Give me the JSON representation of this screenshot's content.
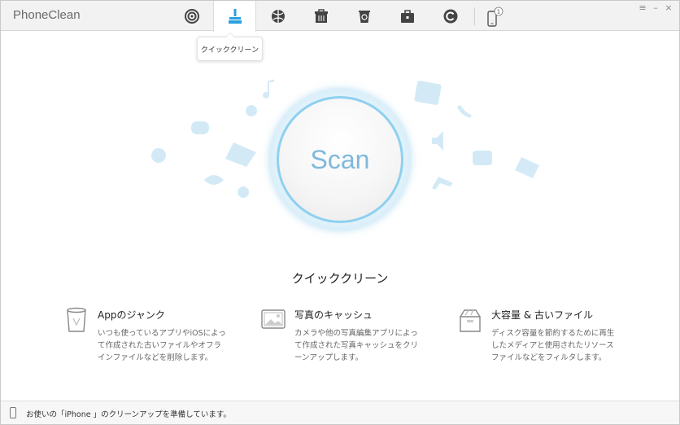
{
  "app": {
    "title": "PhoneClean"
  },
  "toolbar": {
    "tabs": [
      {
        "icon": "intelligent-clean-icon"
      },
      {
        "icon": "broom-icon",
        "active": true
      },
      {
        "icon": "internet-clean-icon"
      },
      {
        "icon": "silent-clean-icon"
      },
      {
        "icon": "recycle-bin-icon"
      },
      {
        "icon": "toolkit-icon"
      },
      {
        "icon": "history-icon"
      }
    ],
    "device_badge": "1",
    "tooltip": "クイッククリーン"
  },
  "window_controls": {
    "menu": "≡",
    "minimize": "–",
    "close": "×"
  },
  "scan": {
    "label": "Scan"
  },
  "section": {
    "title": "クイッククリーン"
  },
  "features": [
    {
      "icon": "trash-can-icon",
      "title": "Appのジャンク",
      "desc": "いつも使っているアプリやiOSによって作成された古いファイルやオフラインファイルなどを削除します。"
    },
    {
      "icon": "photo-icon",
      "title": "写真のキャッシュ",
      "desc": "カメラや他の写真編集アプリによって作成された写真キャッシュをクリーンアップします。"
    },
    {
      "icon": "box-icon",
      "title": "大容量 & 古いファイル",
      "desc": "ディスク容量を節約するために再生したメディアと使用されたリソースファイルなどをフィルタします。"
    }
  ],
  "status": {
    "text": "お使いの「iPhone 」のクリーンアップを準備しています。"
  },
  "colors": {
    "accent": "#2aa0e0",
    "scan_text": "#7fb9dc",
    "ring": "#8fd0f0"
  }
}
